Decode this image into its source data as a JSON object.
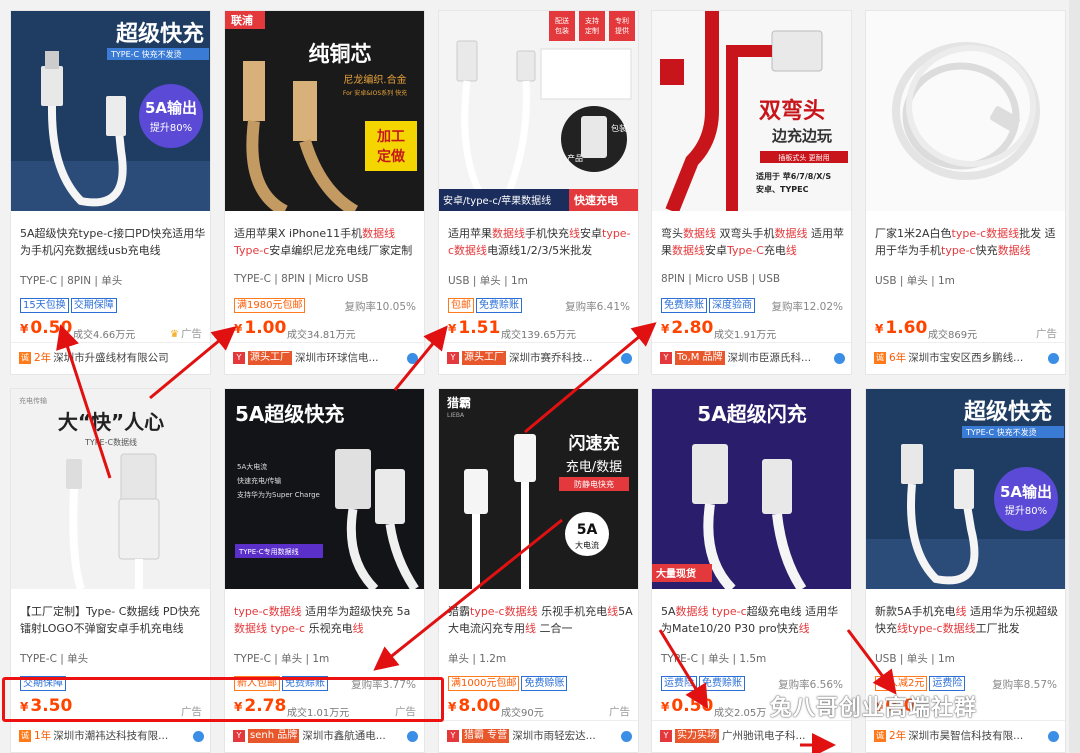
{
  "products": [
    {
      "banner": "超级快充",
      "banner_sub": "TYPE-C 快充不发烫",
      "badge": "5A输出",
      "badge_sub": "提升80%",
      "title_parts": [
        {
          "t": "5A超级快充type-c接口PD快充适用华为手机闪充数据线usb充电线",
          "hl": false
        }
      ],
      "specs": "TYPE-C | 8PIN | 单头",
      "tags": [
        {
          "t": "15天包换",
          "c": "blue"
        },
        {
          "t": "交期保障",
          "c": "blue"
        }
      ],
      "rate": "",
      "price": "0.50",
      "sales": "成交4.66万元",
      "ad": "广告",
      "crown": true,
      "shop_years": "2年",
      "shop_badge": "",
      "shop_name": "深圳市升盛线材有限公司"
    },
    {
      "corner": "联浦",
      "banner": "纯铜芯",
      "banner_sub": "尼龙编织.合金",
      "banner_sub2": "For 安卓&IOS系列 快充",
      "badge": "加工定做",
      "title_parts": [
        {
          "t": "适用苹果X iPhone11手机",
          "hl": false
        },
        {
          "t": "数据线Type-c",
          "hl": true
        },
        {
          "t": "安卓编织尼龙充电线厂家定制",
          "hl": false
        }
      ],
      "specs": "TYPE-C | 8PIN | Micro USB",
      "tags": [
        {
          "t": "满1980元包邮",
          "c": "orange"
        }
      ],
      "rate": "复购率10.05%",
      "price": "1.00",
      "sales": "成交34.81万元",
      "ad": "",
      "crown": false,
      "shop_years": "",
      "shop_badge": "源头工厂",
      "shop_name": "深圳市环球信电..."
    },
    {
      "corner_tags": [
        "配送包装",
        "支持定制",
        "专利提供"
      ],
      "banner": "安卓/type-c/苹果数据线",
      "badge": "快速充电",
      "pkg_label": "包装",
      "prod_label": "产品",
      "title_parts": [
        {
          "t": "适用苹果",
          "hl": false
        },
        {
          "t": "数据线",
          "hl": true
        },
        {
          "t": "手机快充",
          "hl": false
        },
        {
          "t": "线",
          "hl": true
        },
        {
          "t": "安卓",
          "hl": false
        },
        {
          "t": "type-c数据线",
          "hl": true
        },
        {
          "t": "电源线1/2/3/5米批发",
          "hl": false
        }
      ],
      "specs": "USB | 单头 | 1m",
      "tags": [
        {
          "t": "包邮",
          "c": "orange"
        },
        {
          "t": "免费赊账",
          "c": "blue"
        }
      ],
      "rate": "复购率6.41%",
      "price": "1.51",
      "sales": "成交139.65万元",
      "ad": "",
      "crown": false,
      "shop_years": "",
      "shop_badge": "源头工厂",
      "shop_name": "深圳市赛乔科技..."
    },
    {
      "banner": "双弯头",
      "banner_sub": "边充边玩",
      "banner_sub2": "插板式头  更耐用",
      "banner_sub3": "适用于 苹6/7/8/X/S",
      "banner_sub4": "安卓、TYPEC",
      "title_parts": [
        {
          "t": "弯头",
          "hl": false
        },
        {
          "t": "数据线",
          "hl": true
        },
        {
          "t": " 双弯头手机",
          "hl": false
        },
        {
          "t": "数据线",
          "hl": true
        },
        {
          "t": " 适用苹果",
          "hl": false
        },
        {
          "t": "数据线",
          "hl": true
        },
        {
          "t": "安卓",
          "hl": false
        },
        {
          "t": "Type-C",
          "hl": true
        },
        {
          "t": "充电",
          "hl": false
        },
        {
          "t": "线",
          "hl": true
        }
      ],
      "specs": "8PIN | Micro USB | USB",
      "tags": [
        {
          "t": "免费赊账",
          "c": "blue"
        },
        {
          "t": "深度验商",
          "c": "blue"
        }
      ],
      "rate": "复购率12.02%",
      "price": "2.80",
      "sales": "成交1.91万元",
      "ad": "",
      "crown": false,
      "shop_years": "",
      "shop_badge": "To,M 品牌",
      "shop_name": "深圳市臣源氏科..."
    },
    {
      "title_parts": [
        {
          "t": "厂家1米2A白色",
          "hl": false
        },
        {
          "t": "type-c数据线",
          "hl": true
        },
        {
          "t": "批发 适用于华为手机",
          "hl": false
        },
        {
          "t": "type-c",
          "hl": true
        },
        {
          "t": "快充",
          "hl": false
        },
        {
          "t": "数据线",
          "hl": true
        }
      ],
      "specs": "USB | 单头 | 1m",
      "tags": [],
      "rate": "",
      "price": "1.60",
      "sales": "成交869元",
      "ad": "广告",
      "crown": false,
      "shop_years": "6年",
      "shop_badge": "",
      "shop_name": "深圳市宝安区西乡鹏线..."
    },
    {
      "banner": "大“快”人心",
      "banner_sub": "TYPE-C数据线",
      "corner": "充电传输",
      "title_parts": [
        {
          "t": "【工厂定制】Type- C数据线 PD快充镭射LOGO不弹窗安卓手机充电线",
          "hl": false
        }
      ],
      "specs": "TYPE-C | 单头",
      "tags": [
        {
          "t": "交期保障",
          "c": "blue"
        }
      ],
      "rate": "",
      "price": "3.50",
      "sales": "",
      "ad": "广告",
      "crown": false,
      "shop_years": "1年",
      "shop_badge": "",
      "shop_name": "深圳市潮祎达科技有限..."
    },
    {
      "banner": "5A超级快充",
      "list": [
        "5A大电流",
        "快速充电/传输",
        "支持华为为Super Charge"
      ],
      "badge": "TYPE-C专用数据线",
      "title_parts": [
        {
          "t": "type-c数据线",
          "hl": true
        },
        {
          "t": " 适用华为超级快充 5a",
          "hl": false
        },
        {
          "t": "数据线 type-c",
          "hl": true
        },
        {
          "t": " 乐视充电",
          "hl": false
        },
        {
          "t": "线",
          "hl": true
        }
      ],
      "specs": "TYPE-C | 单头 | 1m",
      "tags": [
        {
          "t": "新人包邮",
          "c": "orange"
        },
        {
          "t": "免费赊账",
          "c": "blue"
        }
      ],
      "rate": "复购率3.77%",
      "price": "2.78",
      "sales": "成交1.01万元",
      "ad": "广告",
      "crown": false,
      "shop_years": "",
      "shop_badge": "senh 品牌",
      "shop_name": "深圳市鑫航通电..."
    },
    {
      "corner": "猎霸",
      "corner_sub": "LIEBA",
      "banner": "闪速充",
      "banner_sub": "充电/数据",
      "banner_sub2": "防静电快充",
      "badge": "5A",
      "badge_sub": "大电流",
      "title_parts": [
        {
          "t": "猎霸",
          "hl": false
        },
        {
          "t": "type-c数据线",
          "hl": true
        },
        {
          "t": " 乐视手机充电",
          "hl": false
        },
        {
          "t": "线",
          "hl": true
        },
        {
          "t": "5A大电流闪充专用",
          "hl": false
        },
        {
          "t": "线",
          "hl": true
        },
        {
          "t": " 二合一",
          "hl": false
        }
      ],
      "specs": "单头 | 1.2m",
      "tags": [
        {
          "t": "满1000元包邮",
          "c": "orange"
        },
        {
          "t": "免费赊账",
          "c": "blue"
        }
      ],
      "rate": "",
      "price": "8.00",
      "sales": "成交90元",
      "ad": "广告",
      "crown": false,
      "shop_years": "",
      "shop_badge": "猎霸 专营",
      "shop_name": "深圳市雨轻宏达..."
    },
    {
      "banner": "5A超级闪充",
      "corner": "大量现货",
      "title_parts": [
        {
          "t": "5A",
          "hl": false
        },
        {
          "t": "数据线 type-c",
          "hl": true
        },
        {
          "t": "超级充电线 适用华为Mate10/20 P30 pro快充",
          "hl": false
        },
        {
          "t": "线",
          "hl": true
        }
      ],
      "specs": "TYPE-C | 单头 | 1.5m",
      "tags": [
        {
          "t": "运费险",
          "c": "blue"
        },
        {
          "t": "免费赊账",
          "c": "blue"
        }
      ],
      "rate": "复购率6.56%",
      "price": "0.50",
      "sales": "成交2.05万",
      "ad": "",
      "crown": false,
      "shop_years": "",
      "shop_badge": "实力实场",
      "shop_name": "广州驰讯电子科..."
    },
    {
      "banner": "超级快充",
      "banner_sub": "TYPE-C 快充不发烫",
      "badge": "5A输出",
      "badge_sub": "提升80%",
      "title_parts": [
        {
          "t": "新款5A手机充电",
          "hl": false
        },
        {
          "t": "线",
          "hl": true
        },
        {
          "t": " 适用华为乐视超级快充",
          "hl": false
        },
        {
          "t": "线type-c数据线",
          "hl": true
        },
        {
          "t": "工厂批发",
          "hl": false
        }
      ],
      "specs": "USB | 单头 | 1m",
      "tags": [
        {
          "t": "新人减2元",
          "c": "orange"
        },
        {
          "t": "运费险",
          "c": "blue"
        }
      ],
      "rate": "复购率8.57%",
      "price": "0.0",
      "sales": "",
      "ad": "",
      "crown": false,
      "shop_years": "2年",
      "shop_badge": "",
      "shop_name": "深圳市昊智信科技有限..."
    }
  ],
  "watermark": "兔八哥创业高端社群",
  "colors": {
    "price": "#ff4400",
    "highlight": "#e4393c",
    "tag_blue": "#2b6fd6",
    "tag_orange": "#ff5a00",
    "annotation": "#e11111"
  }
}
